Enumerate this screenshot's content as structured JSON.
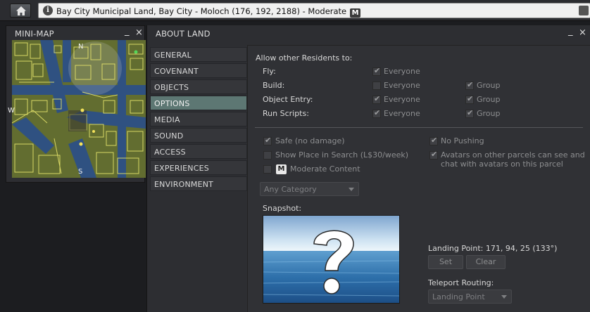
{
  "topbar": {
    "location": "Bay City Municipal Land, Bay City - Moloch (176, 192, 2188) - Moderate",
    "maturity_badge": "M",
    "info_icon": "i"
  },
  "minimap": {
    "title": "MINI-MAP",
    "minimize": "_",
    "close": "×",
    "compass": {
      "n": "N",
      "s": "S",
      "w": "W"
    }
  },
  "aboutland": {
    "title": "ABOUT LAND",
    "minimize": "_",
    "close": "×",
    "tabs": [
      {
        "label": "GENERAL"
      },
      {
        "label": "COVENANT"
      },
      {
        "label": "OBJECTS"
      },
      {
        "label": "OPTIONS",
        "active": true
      },
      {
        "label": "MEDIA"
      },
      {
        "label": "SOUND"
      },
      {
        "label": "ACCESS"
      },
      {
        "label": "EXPERIENCES"
      },
      {
        "label": "ENVIRONMENT"
      }
    ]
  },
  "options": {
    "header": "Allow other Residents to:",
    "rows": [
      {
        "label": "Fly:",
        "everyone": "Everyone",
        "everyone_checked": true
      },
      {
        "label": "Build:",
        "everyone": "Everyone",
        "everyone_checked": false,
        "group": "Group",
        "group_checked": true
      },
      {
        "label": "Object Entry:",
        "everyone": "Everyone",
        "everyone_checked": true,
        "group": "Group",
        "group_checked": true
      },
      {
        "label": "Run Scripts:",
        "everyone": "Everyone",
        "everyone_checked": true,
        "group": "Group",
        "group_checked": true
      }
    ],
    "safe": "Safe (no damage)",
    "no_pushing": "No Pushing",
    "show_place": "Show Place in Search (L$30/week)",
    "avatars_line1": "Avatars on other parcels can see and",
    "avatars_line2": "chat with avatars on this parcel",
    "moderate_badge": "M",
    "moderate": "Moderate Content",
    "category": "Any Category",
    "snapshot_label": "Snapshot:",
    "landing_point": "Landing Point: 171, 94, 25 (133°)",
    "set": "Set",
    "clear": "Clear",
    "teleport_routing": "Teleport Routing:",
    "routing_value": "Landing Point"
  }
}
